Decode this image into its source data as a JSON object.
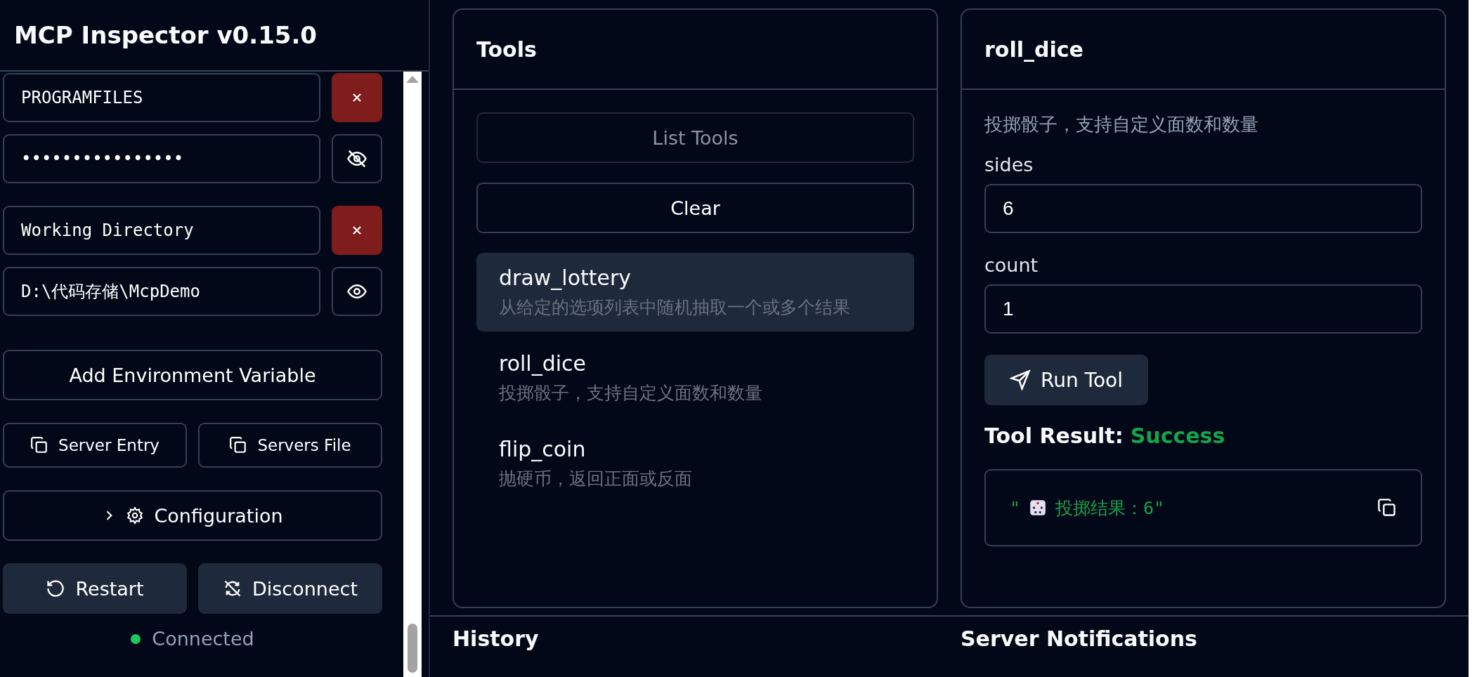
{
  "sidebar": {
    "title": "MCP Inspector v0.15.0",
    "env_vars": [
      {
        "key": "PROGRAMFILES",
        "value": "••••••••••••••••",
        "value_visible": false
      },
      {
        "key": "Working Directory",
        "value": "D:\\代码存储\\McpDemo",
        "value_visible": true
      }
    ],
    "add_button": "Add Environment Variable",
    "copy_buttons": [
      "Server Entry",
      "Servers File"
    ],
    "configuration": {
      "label": "Configuration",
      "expanded": false
    },
    "restart_button": "Restart",
    "disconnect_button": "Disconnect",
    "status": {
      "label": "Connected",
      "connected": true
    }
  },
  "tools_panel": {
    "title": "Tools",
    "list_button": {
      "label": "List Tools",
      "disabled": true
    },
    "clear_button": "Clear",
    "tools": [
      {
        "name": "draw_lottery",
        "description": "从给定的选项列表中随机抽取一个或多个结果",
        "selected": true
      },
      {
        "name": "roll_dice",
        "description": "投掷骰子，支持自定义面数和数量",
        "selected": false
      },
      {
        "name": "flip_coin",
        "description": "抛硬币，返回正面或反面",
        "selected": false
      }
    ]
  },
  "tool_panel": {
    "title": "roll_dice",
    "description": "投掷骰子，支持自定义面数和数量",
    "params": [
      {
        "label": "sides",
        "value": "6"
      },
      {
        "label": "count",
        "value": "1"
      }
    ],
    "run_button": "Run Tool",
    "result_label": "Tool Result:",
    "result_status": "Success",
    "result_ok": true,
    "result_prefix": "\"",
    "result_text": "投掷结果：6\""
  },
  "bottom_panels": [
    "History",
    "Server Notifications"
  ]
}
